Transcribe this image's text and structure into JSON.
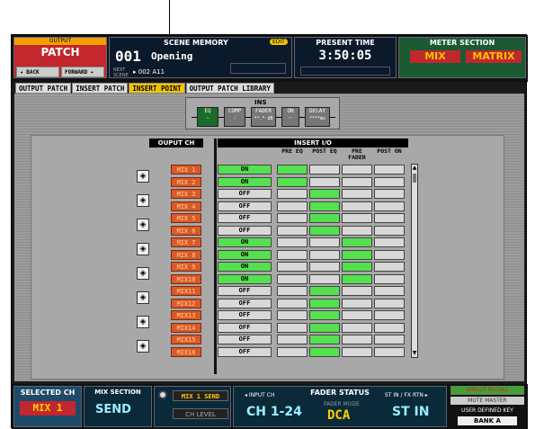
{
  "header": {
    "output_label": "OUTPUT",
    "patch_title": "PATCH",
    "back": "◂ BACK",
    "forward": "FORWARD ▸",
    "scene_memory_label": "SCENE MEMORY",
    "edit_badge": "EDIT",
    "scene_number": "001",
    "scene_name": "Opening",
    "next_scene_label": "NEXT SCENE",
    "next_scene": "▸ 002 A11",
    "present_time_label": "PRESENT TIME",
    "present_time": "3:50:05",
    "meter_section_label": "METER SECTION",
    "meter_mix": "MIX",
    "meter_matrix": "MATRIX"
  },
  "tabs": [
    "OUTPUT PATCH",
    "INSERT PATCH",
    "INSERT POINT",
    "OUTPUT PATCH LIBRARY"
  ],
  "ins": {
    "label": "INS",
    "modules": [
      {
        "name": "EQ"
      },
      {
        "name": "COMP"
      },
      {
        "name": "FADER",
        "val": "**.* dB"
      },
      {
        "name": "ON"
      },
      {
        "name": "DELAY",
        "val": "****ms"
      }
    ]
  },
  "table": {
    "output_ch_label": "OUPUT CH",
    "insert_io_label": "INSERT I/O",
    "col_headers": [
      "PRE EQ",
      "POST EQ",
      "PRE FADER",
      "POST ON"
    ],
    "rows": [
      {
        "ch": "MIX 1",
        "status": "ON",
        "pre_eq": true,
        "post_eq": false,
        "pre_fader": false,
        "post_on": false
      },
      {
        "ch": "MIX 2",
        "status": "ON",
        "pre_eq": true,
        "post_eq": false,
        "pre_fader": false,
        "post_on": false
      },
      {
        "ch": "MIX 3",
        "status": "OFF",
        "pre_eq": false,
        "post_eq": true,
        "pre_fader": false,
        "post_on": false
      },
      {
        "ch": "MIX 4",
        "status": "OFF",
        "pre_eq": false,
        "post_eq": true,
        "pre_fader": false,
        "post_on": false
      },
      {
        "ch": "MIX 5",
        "status": "OFF",
        "pre_eq": false,
        "post_eq": true,
        "pre_fader": false,
        "post_on": false
      },
      {
        "ch": "MIX 6",
        "status": "OFF",
        "pre_eq": false,
        "post_eq": true,
        "pre_fader": false,
        "post_on": false
      },
      {
        "ch": "MIX 7",
        "status": "ON",
        "pre_eq": false,
        "post_eq": false,
        "pre_fader": true,
        "post_on": false
      },
      {
        "ch": "MIX 8",
        "status": "ON",
        "pre_eq": false,
        "post_eq": false,
        "pre_fader": true,
        "post_on": false
      },
      {
        "ch": "MIX 9",
        "status": "ON",
        "pre_eq": false,
        "post_eq": false,
        "pre_fader": true,
        "post_on": false
      },
      {
        "ch": "MIX10",
        "status": "ON",
        "pre_eq": false,
        "post_eq": false,
        "pre_fader": true,
        "post_on": false
      },
      {
        "ch": "MIX11",
        "status": "OFF",
        "pre_eq": false,
        "post_eq": true,
        "pre_fader": false,
        "post_on": false
      },
      {
        "ch": "MIX12",
        "status": "OFF",
        "pre_eq": false,
        "post_eq": true,
        "pre_fader": false,
        "post_on": false
      },
      {
        "ch": "MIX13",
        "status": "OFF",
        "pre_eq": false,
        "post_eq": true,
        "pre_fader": false,
        "post_on": false
      },
      {
        "ch": "MIX14",
        "status": "OFF",
        "pre_eq": false,
        "post_eq": true,
        "pre_fader": false,
        "post_on": false
      },
      {
        "ch": "MIX15",
        "status": "OFF",
        "pre_eq": false,
        "post_eq": true,
        "pre_fader": false,
        "post_on": false
      },
      {
        "ch": "MIX16",
        "status": "OFF",
        "pre_eq": false,
        "post_eq": true,
        "pre_fader": false,
        "post_on": false
      }
    ]
  },
  "footer": {
    "selected_ch_label": "SELECTED CH",
    "selected_ch": "MIX 1",
    "mix_section_label": "MIX SECTION",
    "mix_section": "SEND",
    "send_label": "MIX 1 SEND",
    "ch_level": "CH LEVEL",
    "fader_status_label": "FADER STATUS",
    "input_ch_label": "◂ INPUT CH",
    "input_ch": "CH 1-24",
    "fader_mode_label": "FADER MODE",
    "fader_mode": "DCA",
    "st_in_label": "ST IN / FX RTN ▸",
    "st_in": "ST IN",
    "direct_recall": "DIRECT RECALL",
    "mute_master": "MUTE MASTER",
    "user_defined_key": "USER DEFINED KEY",
    "bank": "BANK A"
  },
  "colors": {
    "on": "#55e050",
    "off": "#d8d8d8",
    "accent": "#f2c400",
    "ch_label": "#d85a2a"
  }
}
